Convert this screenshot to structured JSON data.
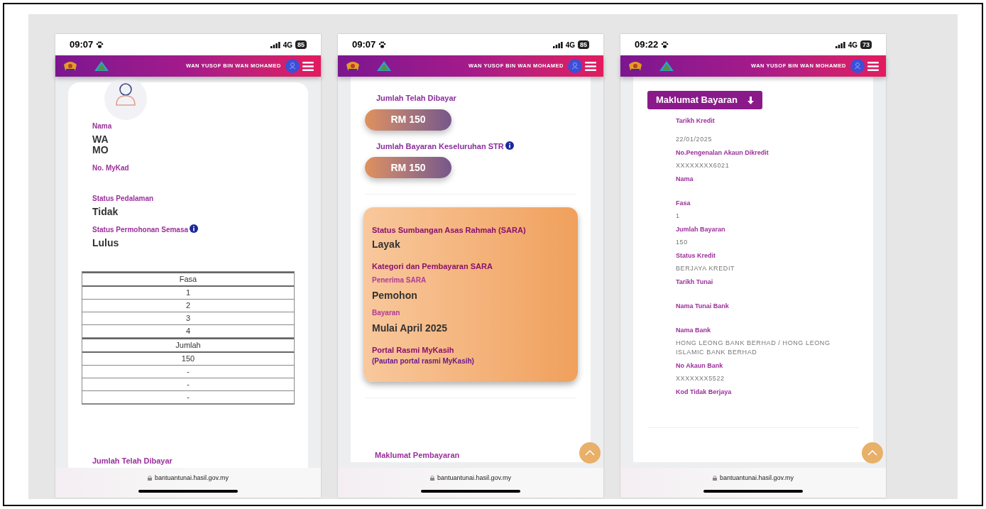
{
  "phones": [
    {
      "status_bar": {
        "time": "09:07",
        "network": "4G",
        "battery": "85"
      },
      "header": {
        "user_name": "WAN YUSOF BIN WAN MOHAMED"
      },
      "back_to_top": false,
      "url": "bantuantunai.hasil.gov.my",
      "content": [
        {
          "kind": "avatar"
        },
        {
          "kind": "field",
          "label": "Nama",
          "value_lines": [
            "WA",
            "MO"
          ],
          "info": false
        },
        {
          "kind": "field",
          "label": "No. MyKad",
          "info": false
        },
        {
          "kind": "field",
          "label": "Status Pedalaman",
          "value_lines": [
            "Tidak"
          ],
          "info": false
        },
        {
          "kind": "field",
          "label": "Status Permohonan Semasa",
          "value_lines": [
            "Lulus"
          ],
          "info": true
        },
        {
          "kind": "table",
          "rows": [
            {
              "text": "Fasa",
              "header": true
            },
            {
              "text": "1",
              "header": false
            },
            {
              "text": "2",
              "header": false
            },
            {
              "text": "3",
              "header": false
            },
            {
              "text": "4",
              "header": false
            },
            {
              "text": "Jumlah",
              "header": true
            },
            {
              "text": "150",
              "header": false
            },
            {
              "text": "-",
              "header": false
            },
            {
              "text": "-",
              "header": false
            },
            {
              "text": "-",
              "header": false
            }
          ]
        },
        {
          "kind": "heading",
          "text": "Jumlah Telah Dibayar"
        }
      ]
    },
    {
      "status_bar": {
        "time": "09:07",
        "network": "4G",
        "battery": "85"
      },
      "header": {
        "user_name": "WAN YUSOF BIN WAN MOHAMED"
      },
      "back_to_top": true,
      "url": "bantuantunai.hasil.gov.my",
      "content": [
        {
          "kind": "amount",
          "label": "Jumlah Telah Dibayar",
          "value": "RM 150",
          "info": false
        },
        {
          "kind": "amount",
          "label": "Jumlah Bayaran Keseluruhan STR",
          "value": "RM 150",
          "info": true
        },
        {
          "kind": "divider"
        },
        {
          "kind": "card",
          "items": [
            {
              "kind": "title",
              "text": "Status Sumbangan Asas Rahmah (SARA)"
            },
            {
              "kind": "value",
              "text": "Layak"
            },
            {
              "kind": "title",
              "text": "Kategori dan Pembayaran SARA"
            },
            {
              "kind": "label",
              "text": "Penerima SARA"
            },
            {
              "kind": "value",
              "text": "Pemohon"
            },
            {
              "kind": "label",
              "text": "Bayaran"
            },
            {
              "kind": "value",
              "text": "Mulai April 2025"
            },
            {
              "kind": "title",
              "text": "Portal Rasmi MyKasih"
            },
            {
              "kind": "link",
              "text": "(Pautan portal rasmi MyKasih)"
            }
          ]
        },
        {
          "kind": "divider"
        },
        {
          "kind": "heading",
          "text": "Maklumat Pembayaran"
        }
      ]
    },
    {
      "status_bar": {
        "time": "09:22",
        "network": "4G",
        "battery": "73"
      },
      "header": {
        "user_name": "WAN YUSOF BIN WAN MOHAMED"
      },
      "back_to_top": true,
      "url": "bantuantunai.hasil.gov.my",
      "content": [
        {
          "kind": "section_button",
          "text": "Maklumat Bayaran"
        },
        {
          "kind": "details",
          "items": [
            {
              "label": "Tarikh Kredit",
              "value": "22/01/2025"
            },
            {
              "label": "No.Pengenalan Akaun Dikredit",
              "value": "XXXXXXXX6021"
            },
            {
              "label": "Nama"
            },
            {
              "label": "Fasa",
              "value": "1"
            },
            {
              "label": "Jumlah Bayaran",
              "value": "150"
            },
            {
              "label": "Status Kredit",
              "value": "BERJAYA KREDIT"
            },
            {
              "label": "Tarikh Tunai"
            },
            {
              "label": "Nama Tunai Bank"
            },
            {
              "label": "Nama Bank",
              "value": "HONG LEONG BANK BERHAD / HONG LEONG ISLAMIC BANK BERHAD"
            },
            {
              "label": "No Akaun Bank",
              "value": "XXXXXXX5522"
            },
            {
              "label": "Kod Tidak Berjaya"
            }
          ]
        },
        {
          "kind": "divider"
        }
      ]
    }
  ]
}
